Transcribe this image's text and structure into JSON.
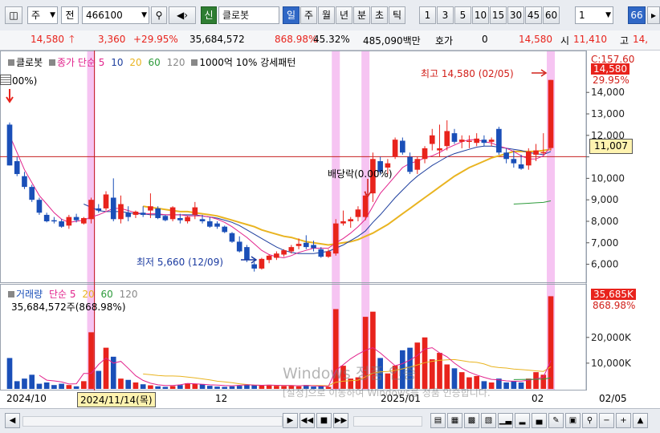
{
  "toolbar": {
    "period_mode": "주",
    "prefix_label": "전",
    "stock_code": "466100",
    "badge_label": "신",
    "stock_name": "클로봇",
    "period_tabs": [
      "일",
      "주",
      "월",
      "년",
      "분",
      "초",
      "틱"
    ],
    "selected_tab": "일",
    "interval_numbers": [
      "1",
      "3",
      "5",
      "10",
      "15",
      "30",
      "45",
      "60"
    ],
    "interval_value": "1",
    "right_value": "66"
  },
  "quote": {
    "price": "14,580",
    "change": "3,360",
    "change_pct": "+29.95%",
    "volume": "35,684,572",
    "volume_ratio": "868.98%",
    "turnover": "45.32%",
    "amount": "485,090백만",
    "ask_label": "호가",
    "ask_value": "0",
    "last": "14,580",
    "open_label": "시",
    "open_value": "11,410",
    "high_label": "고",
    "high_value": "14,"
  },
  "price_legend": {
    "name": "클로봇",
    "close_label": "종가",
    "ma_type": "단순",
    "ma_periods": [
      "5",
      "10",
      "20",
      "60",
      "120"
    ],
    "extra": "1000억 10% 강세패턴"
  },
  "volume_legend": {
    "title": "거래량",
    "ma_type": "단순",
    "ma_periods": [
      "5",
      "20",
      "60",
      "120"
    ],
    "detail": "35,684,572주(868.98%)"
  },
  "price_axis": {
    "ticks": [
      "14,000",
      "13,000",
      "12,000",
      "11,000",
      "10,000",
      "9,000",
      "8,000",
      "7,000",
      "6,000"
    ],
    "top_label": "C:157.60",
    "current_price": "14,580",
    "current_pct": "29.95%",
    "crosshair_value": "11,007"
  },
  "volume_axis": {
    "ticks": [
      "20,000K",
      "10,000K"
    ],
    "current": "35,685K",
    "current_pct": "868.98%"
  },
  "annotations": {
    "high": "최고 14,580 (02/05)",
    "low": "최저 5,660 (12/09)",
    "dividend": "배당락(0.00%)",
    "left_pct": "00%)"
  },
  "date_axis": {
    "labels": [
      "2024/10",
      "12",
      "2025/01",
      "02"
    ],
    "crosshair_date": "2024/11/14(목)",
    "right_date": "02/05"
  },
  "watermark": {
    "line1": "Windows 정품 인증",
    "line2": "[설정]으로 이동하여 Windows를 정품 인증합니다."
  },
  "colors": {
    "up": "#e8231c",
    "down": "#1a4fb8",
    "ma5": "#e2238c",
    "ma10": "#1e3f9e",
    "ma20": "#e9b421",
    "ma60": "#2c9a3a",
    "highlight": "#f6c4f2",
    "crosshair": "#c62020"
  },
  "chart_data": {
    "type": "candlestick",
    "ylim": [
      5200,
      15800
    ],
    "candles": [
      {
        "o": 12500,
        "h": 12600,
        "l": 10600,
        "c": 10600
      },
      {
        "o": 10800,
        "h": 11000,
        "l": 10100,
        "c": 10200
      },
      {
        "o": 10100,
        "h": 10300,
        "l": 9500,
        "c": 9600
      },
      {
        "o": 9600,
        "h": 9700,
        "l": 8900,
        "c": 9000
      },
      {
        "o": 9000,
        "h": 9100,
        "l": 8300,
        "c": 8400
      },
      {
        "o": 8300,
        "h": 8400,
        "l": 7950,
        "c": 8000
      },
      {
        "o": 8050,
        "h": 8200,
        "l": 7900,
        "c": 8000
      },
      {
        "o": 8000,
        "h": 8100,
        "l": 7700,
        "c": 7750
      },
      {
        "o": 7800,
        "h": 8300,
        "l": 7650,
        "c": 8200
      },
      {
        "o": 8200,
        "h": 8350,
        "l": 7950,
        "c": 8050
      },
      {
        "o": 7900,
        "h": 8200,
        "l": 7850,
        "c": 8150
      },
      {
        "o": 8100,
        "h": 9100,
        "l": 7900,
        "c": 9000
      },
      {
        "o": 8600,
        "h": 8800,
        "l": 8400,
        "c": 8500
      },
      {
        "o": 8600,
        "h": 9400,
        "l": 8500,
        "c": 9250
      },
      {
        "o": 9100,
        "h": 10000,
        "l": 8000,
        "c": 8100
      },
      {
        "o": 8100,
        "h": 9200,
        "l": 7900,
        "c": 8800
      },
      {
        "o": 8400,
        "h": 8700,
        "l": 8000,
        "c": 8200
      },
      {
        "o": 8300,
        "h": 8500,
        "l": 8150,
        "c": 8450
      },
      {
        "o": 8400,
        "h": 8700,
        "l": 8200,
        "c": 8300
      },
      {
        "o": 8500,
        "h": 9300,
        "l": 8150,
        "c": 8700
      },
      {
        "o": 8600,
        "h": 8700,
        "l": 8100,
        "c": 8150
      },
      {
        "o": 8250,
        "h": 8300,
        "l": 8000,
        "c": 8050
      },
      {
        "o": 8100,
        "h": 8700,
        "l": 8000,
        "c": 8650
      },
      {
        "o": 8150,
        "h": 8350,
        "l": 7900,
        "c": 8050
      },
      {
        "o": 8000,
        "h": 8250,
        "l": 7900,
        "c": 8200
      },
      {
        "o": 8300,
        "h": 8900,
        "l": 8100,
        "c": 8650
      },
      {
        "o": 8100,
        "h": 8300,
        "l": 7900,
        "c": 8000
      },
      {
        "o": 8000,
        "h": 8200,
        "l": 7700,
        "c": 7750
      },
      {
        "o": 7900,
        "h": 8000,
        "l": 7650,
        "c": 7750
      },
      {
        "o": 7750,
        "h": 7800,
        "l": 7450,
        "c": 7500
      },
      {
        "o": 7450,
        "h": 7500,
        "l": 7000,
        "c": 7050
      },
      {
        "o": 7050,
        "h": 7300,
        "l": 6550,
        "c": 6600
      },
      {
        "o": 6800,
        "h": 6900,
        "l": 6100,
        "c": 6200
      },
      {
        "o": 6000,
        "h": 6100,
        "l": 5660,
        "c": 5800
      },
      {
        "o": 5800,
        "h": 6300,
        "l": 5750,
        "c": 6250
      },
      {
        "o": 6200,
        "h": 6450,
        "l": 6050,
        "c": 6400
      },
      {
        "o": 6300,
        "h": 6600,
        "l": 6200,
        "c": 6500
      },
      {
        "o": 6450,
        "h": 6700,
        "l": 6350,
        "c": 6650
      },
      {
        "o": 6600,
        "h": 6900,
        "l": 6500,
        "c": 6800
      },
      {
        "o": 6850,
        "h": 7200,
        "l": 6700,
        "c": 6950
      },
      {
        "o": 7000,
        "h": 7350,
        "l": 6700,
        "c": 6800
      },
      {
        "o": 6900,
        "h": 7100,
        "l": 6600,
        "c": 6750
      },
      {
        "o": 6700,
        "h": 6800,
        "l": 6300,
        "c": 6350
      },
      {
        "o": 6350,
        "h": 6700,
        "l": 6300,
        "c": 6600
      },
      {
        "o": 6500,
        "h": 8100,
        "l": 6400,
        "c": 7900
      },
      {
        "o": 7900,
        "h": 8500,
        "l": 7800,
        "c": 8000
      },
      {
        "o": 8000,
        "h": 8200,
        "l": 7700,
        "c": 8100
      },
      {
        "o": 8200,
        "h": 8700,
        "l": 8000,
        "c": 8550
      },
      {
        "o": 8200,
        "h": 9400,
        "l": 8050,
        "c": 9200
      },
      {
        "o": 9300,
        "h": 11200,
        "l": 8900,
        "c": 10900
      },
      {
        "o": 10800,
        "h": 11000,
        "l": 10150,
        "c": 10300
      },
      {
        "o": 10500,
        "h": 10900,
        "l": 10200,
        "c": 10700
      },
      {
        "o": 11000,
        "h": 11900,
        "l": 10900,
        "c": 11800
      },
      {
        "o": 11750,
        "h": 11900,
        "l": 11100,
        "c": 11200
      },
      {
        "o": 11000,
        "h": 11200,
        "l": 10200,
        "c": 10300
      },
      {
        "o": 10400,
        "h": 11000,
        "l": 10200,
        "c": 10900
      },
      {
        "o": 10900,
        "h": 11500,
        "l": 10700,
        "c": 11400
      },
      {
        "o": 11600,
        "h": 12300,
        "l": 11300,
        "c": 12000
      },
      {
        "o": 11300,
        "h": 12500,
        "l": 11000,
        "c": 11400
      },
      {
        "o": 11500,
        "h": 12700,
        "l": 11300,
        "c": 12200
      },
      {
        "o": 12100,
        "h": 12300,
        "l": 11600,
        "c": 11700
      },
      {
        "o": 11700,
        "h": 12000,
        "l": 11400,
        "c": 11800
      },
      {
        "o": 11700,
        "h": 12000,
        "l": 11400,
        "c": 11750
      },
      {
        "o": 11650,
        "h": 12100,
        "l": 11500,
        "c": 11850
      },
      {
        "o": 11800,
        "h": 12000,
        "l": 11500,
        "c": 11650
      },
      {
        "o": 11700,
        "h": 11900,
        "l": 11500,
        "c": 11800
      },
      {
        "o": 12300,
        "h": 12400,
        "l": 11100,
        "c": 11200
      },
      {
        "o": 11200,
        "h": 11400,
        "l": 10700,
        "c": 10900
      },
      {
        "o": 10900,
        "h": 11300,
        "l": 10500,
        "c": 10700
      },
      {
        "o": 10650,
        "h": 11100,
        "l": 10400,
        "c": 10450
      },
      {
        "o": 10600,
        "h": 11400,
        "l": 10400,
        "c": 11250
      },
      {
        "o": 11100,
        "h": 11600,
        "l": 10800,
        "c": 11300
      },
      {
        "o": 11200,
        "h": 12100,
        "l": 11100,
        "c": 11220
      },
      {
        "o": 11410,
        "h": 14580,
        "l": 11300,
        "c": 14580
      }
    ],
    "volume_k": [
      12000,
      3000,
      4000,
      5500,
      2000,
      2500,
      1500,
      2000,
      1500,
      1000,
      3000,
      22000,
      7000,
      16000,
      12500,
      4000,
      3500,
      2500,
      1800,
      1400,
      1000,
      800,
      1100,
      1500,
      2200,
      2000,
      1800,
      1200,
      900,
      800,
      1000,
      1200,
      1500,
      1500,
      1300,
      1600,
      1200,
      1100,
      1300,
      1000,
      1500,
      900,
      1200,
      800,
      31000,
      9000,
      4000,
      4500,
      28000,
      30000,
      12000,
      6000,
      9000,
      15000,
      16000,
      18000,
      20000,
      11500,
      14000,
      9500,
      8000,
      6500,
      4500,
      5000,
      3000,
      2500,
      4000,
      2500,
      3000,
      2500,
      4000,
      6500,
      5500,
      36000
    ],
    "ma5": [
      12000,
      11200,
      10400,
      9800,
      9200,
      8800,
      8400,
      8100,
      7950,
      8000,
      8050,
      8200,
      8300,
      8450,
      8600,
      8600,
      8500,
      8400,
      8350,
      8350,
      8350,
      8300,
      8300,
      8300,
      8250,
      8250,
      8250,
      8200,
      8100,
      7950,
      7750,
      7500,
      7250,
      6950,
      6650,
      6450,
      6350,
      6300,
      6400,
      6550,
      6650,
      6750,
      6750,
      6750,
      7000,
      7200,
      7450,
      7750,
      8100,
      8700,
      9300,
      9700,
      10100,
      10500,
      10700,
      10800,
      10950,
      11050,
      11200,
      11400,
      11550,
      11700,
      11800,
      11800,
      11700,
      11650,
      11500,
      11400,
      11250,
      11050,
      10900,
      10900,
      11050,
      11500
    ],
    "ma10": [
      null,
      null,
      null,
      null,
      null,
      null,
      null,
      null,
      null,
      null,
      8800,
      8650,
      8500,
      8450,
      8450,
      8450,
      8400,
      8350,
      8350,
      8300,
      8300,
      8300,
      8300,
      8300,
      8300,
      8300,
      8250,
      8200,
      8150,
      8050,
      7950,
      7800,
      7600,
      7400,
      7200,
      7000,
      6800,
      6650,
      6550,
      6500,
      6500,
      6500,
      6550,
      6600,
      6750,
      6900,
      7100,
      7300,
      7550,
      7950,
      8300,
      8700,
      9100,
      9450,
      9800,
      10100,
      10350,
      10600,
      10800,
      11000,
      11150,
      11250,
      11350,
      11450,
      11500,
      11500,
      11450,
      11400,
      11350,
      11300,
      11200,
      11150,
      11100,
      11250
    ],
    "ma20": [
      null,
      null,
      null,
      null,
      null,
      null,
      null,
      null,
      null,
      null,
      null,
      null,
      null,
      null,
      null,
      null,
      null,
      null,
      8700,
      8650,
      8600,
      8550,
      8500,
      8450,
      8450,
      8400,
      8350,
      8300,
      8250,
      8150,
      8050,
      7950,
      7850,
      7750,
      7600,
      7500,
      7400,
      7300,
      7250,
      7150,
      7050,
      7000,
      6950,
      6900,
      6950,
      7000,
      7050,
      7150,
      7300,
      7450,
      7650,
      7850,
      8100,
      8350,
      8600,
      8850,
      9100,
      9350,
      9600,
      9850,
      10100,
      10300,
      10500,
      10650,
      10800,
      10950,
      11050,
      11150,
      11250,
      11250,
      11250,
      11250,
      11300,
      11350
    ],
    "ma60": [
      null,
      null,
      null,
      null,
      null,
      null,
      null,
      null,
      null,
      null,
      null,
      null,
      null,
      null,
      null,
      null,
      null,
      null,
      null,
      null,
      null,
      null,
      null,
      null,
      null,
      null,
      null,
      null,
      null,
      null,
      null,
      null,
      null,
      null,
      null,
      null,
      null,
      null,
      null,
      null,
      null,
      null,
      null,
      null,
      null,
      null,
      null,
      null,
      null,
      null,
      null,
      null,
      null,
      null,
      null,
      null,
      null,
      null,
      null,
      null,
      null,
      null,
      null,
      null,
      null,
      null,
      null,
      null,
      8800,
      8820,
      8840,
      8860,
      8880,
      8950
    ],
    "vma5": [
      null,
      null,
      null,
      null,
      5300,
      3400,
      3100,
      2700,
      1900,
      2000,
      6000,
      6000,
      9500,
      12000,
      10000,
      10700,
      8000,
      5100,
      3300,
      2200,
      1600,
      1300,
      1300,
      1600,
      2100,
      2000,
      1800,
      1600,
      1500,
      1300,
      1200,
      1400,
      1600,
      1500,
      1400,
      1500,
      1400,
      1300,
      1300,
      1200,
      1300,
      1200,
      1100,
      1000,
      7200,
      9400,
      11700,
      13500,
      15000,
      16000,
      14000,
      11500,
      9000,
      9800,
      11200,
      13000,
      15500,
      16000,
      14000,
      12500,
      10000,
      8000,
      6500,
      5400,
      4500,
      3700,
      3500,
      3100,
      3000,
      3000,
      3400,
      3900,
      4600,
      11000
    ],
    "vma20": [
      null,
      null,
      null,
      null,
      null,
      null,
      null,
      null,
      null,
      null,
      null,
      null,
      null,
      null,
      null,
      null,
      null,
      null,
      5800,
      5500,
      5200,
      5000,
      5000,
      4900,
      4600,
      4300,
      3900,
      3500,
      3000,
      2700,
      2400,
      2000,
      1700,
      1500,
      1400,
      1400,
      1300,
      1300,
      1300,
      1200,
      1300,
      1300,
      1300,
      1200,
      2600,
      3000,
      3200,
      3400,
      4700,
      6100,
      6600,
      6800,
      7200,
      7800,
      8500,
      9300,
      10200,
      10700,
      11100,
      11300,
      11400,
      11000,
      10500,
      10300,
      9700,
      8700,
      8300,
      8100,
      7700,
      7500,
      7300,
      7000,
      6800,
      8600
    ],
    "vma60": [
      null,
      null,
      null,
      null,
      null,
      null,
      null,
      null,
      null,
      null,
      null,
      null,
      null,
      null,
      null,
      null,
      null,
      null,
      null,
      null,
      null,
      null,
      null,
      null,
      null,
      null,
      null,
      null,
      null,
      null,
      null,
      null,
      null,
      null,
      null,
      null,
      null,
      null,
      null,
      null,
      null,
      null,
      null,
      null,
      null,
      null,
      null,
      null,
      null,
      null,
      null,
      null,
      null,
      null,
      null,
      null,
      null,
      null,
      null,
      null,
      null,
      null,
      null,
      null,
      null,
      null,
      null,
      null,
      3600,
      3650,
      3700,
      3750,
      3800,
      4300
    ]
  }
}
